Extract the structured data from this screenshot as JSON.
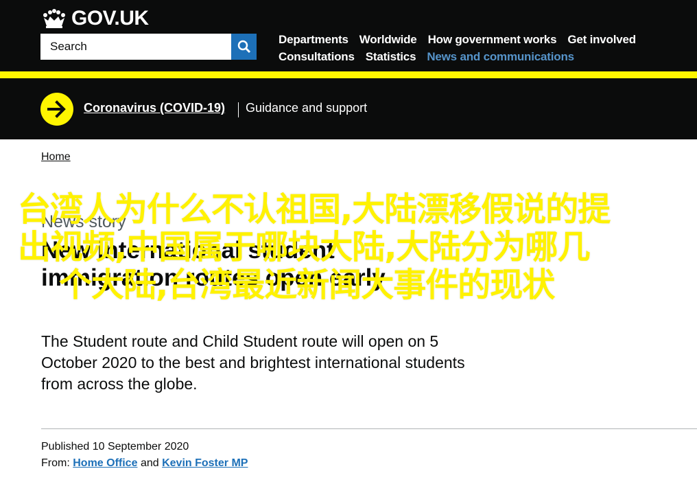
{
  "header": {
    "logo_text": "GOV.UK",
    "search_placeholder": "Search",
    "nav_row1": [
      "Departments",
      "Worldwide",
      "How government works",
      "Get involved"
    ],
    "nav_row2": [
      "Consultations",
      "Statistics",
      "News and communications"
    ],
    "active_nav": "News and communications"
  },
  "covid_banner": {
    "link": "Coronavirus (COVID-19)",
    "text": "Guidance and support"
  },
  "breadcrumb": "Home",
  "article": {
    "type": "News story",
    "title": "New international student immigration routes open early",
    "lead": "The Student route and Child Student route will open on 5 October 2020 to the best and brightest international students from across the globe.",
    "published_label": "Published",
    "published_date": "10 September 2020",
    "from_label": "From:",
    "from_org1": "Home Office",
    "from_and": "and",
    "from_org2": "Kevin Foster MP"
  },
  "overlay": {
    "line1": "台湾人为什么不认祖国,大陆漂移假说的提",
    "line2": "出视频,中国属于哪块大陆,大陆分为哪几",
    "line3": "个大陆,台湾最近新闻大事件的现状"
  },
  "colors": {
    "header_bg": "#0b0c0c",
    "accent_yellow": "#fff500",
    "link_blue": "#1d70b8",
    "active_nav": "#5694ca",
    "overlay_text": "#fff200"
  }
}
